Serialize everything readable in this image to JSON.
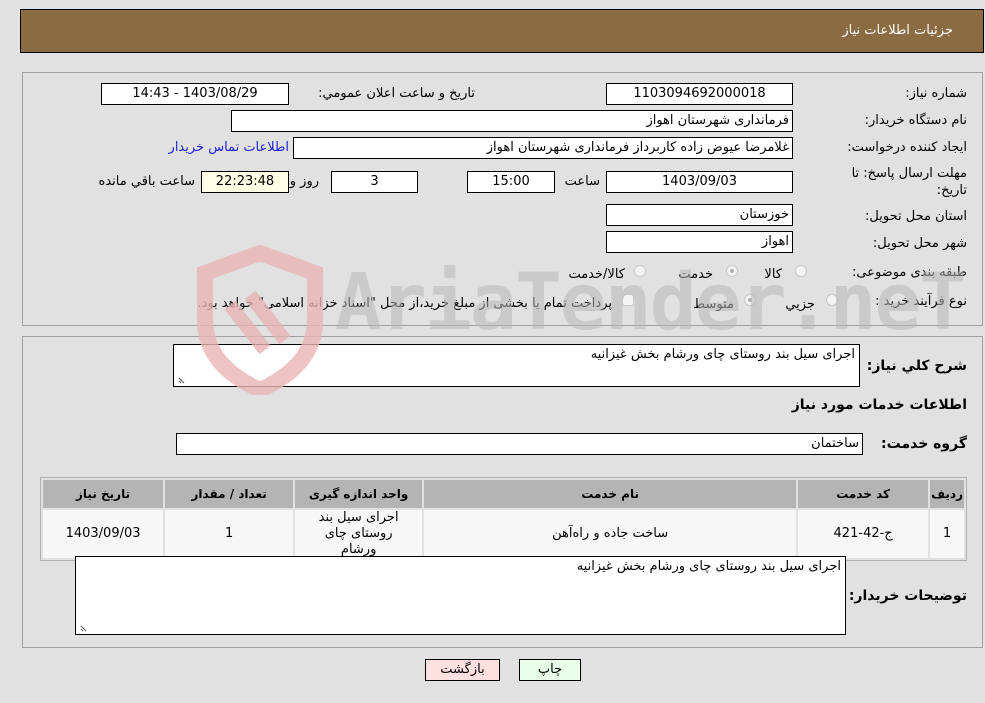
{
  "header": {
    "title": "جزئیات اطلاعات نیاز"
  },
  "details": {
    "need_number_label": "شماره نیاز:",
    "need_number": "1103094692000018",
    "announce_label": "تاریخ و ساعت اعلان عمومي:",
    "announce_value": "1403/08/29 - 14:43",
    "buyer_org_label": "نام دستگاه خریدار:",
    "buyer_org": "فرمانداری شهرستان اهواز",
    "creator_label": "ایجاد کننده درخواست:",
    "creator": "غلامرضا عیوض زاده  کاربرداز فرمانداری شهرستان اهواز",
    "contact_link": "اطلاعات تماس خریدار",
    "deadline_label": "مهلت ارسال پاسخ: تا تاریخ:",
    "deadline_date": "1403/09/03",
    "time_label": "ساعت",
    "deadline_time": "15:00",
    "days_value": "3",
    "days_label": "روز و",
    "remaining_time": "22:23:48",
    "remaining_label": "ساعت باقي مانده",
    "province_label": "استان محل تحویل:",
    "province": "خوزستان",
    "city_label": "شهر محل تحویل:",
    "city": "اهواز",
    "category_label": "طبقه بندی موضوعی:",
    "category_options": [
      {
        "label": "کالا",
        "checked": false
      },
      {
        "label": "خدمت",
        "checked": true
      },
      {
        "label": "کالا/خدمت",
        "checked": false
      }
    ],
    "process_label": "نوع فرآیند خرید :",
    "process_options": [
      {
        "label": "جزيي",
        "checked": false
      },
      {
        "label": "متوسط",
        "checked": true
      }
    ],
    "treasury_note": "پرداخت تمام یا بخشی از مبلغ خرید،از محل \"اسناد خزانه اسلامی\" خواهد بود.",
    "treasury_checked": false
  },
  "services": {
    "summary_label": "شرح کلي نیاز:",
    "summary": "اجرای سیل بند روستای چای ورشام بخش غیزانیه",
    "section_title": "اطلاعات خدمات مورد نیاز",
    "group_label": "گروه خدمت:",
    "group": "ساختمان",
    "table": {
      "headers": [
        "ردیف",
        "کد خدمت",
        "نام خدمت",
        "واحد اندازه گیری",
        "تعداد / مقدار",
        "تاریخ نیاز"
      ],
      "rows": [
        [
          "1",
          "ج-42-421",
          "ساخت جاده و راه‌آهن",
          "اجرای سیل بند روستای چای ورشام",
          "1",
          "1403/09/03"
        ]
      ]
    },
    "buyer_notes_label": "توضیحات خریدار:",
    "buyer_notes": "اجرای سیل بند روستای چای ورشام بخش غیزانیه"
  },
  "buttons": {
    "print": "چاپ",
    "back": "بازگشت"
  },
  "watermark": {
    "text": "AriaTender.neT"
  },
  "colors": {
    "header_bg": "#8b6b42",
    "print_bg": "#eaffea",
    "back_bg": "#ffe0e0",
    "link": "#2222dd"
  }
}
